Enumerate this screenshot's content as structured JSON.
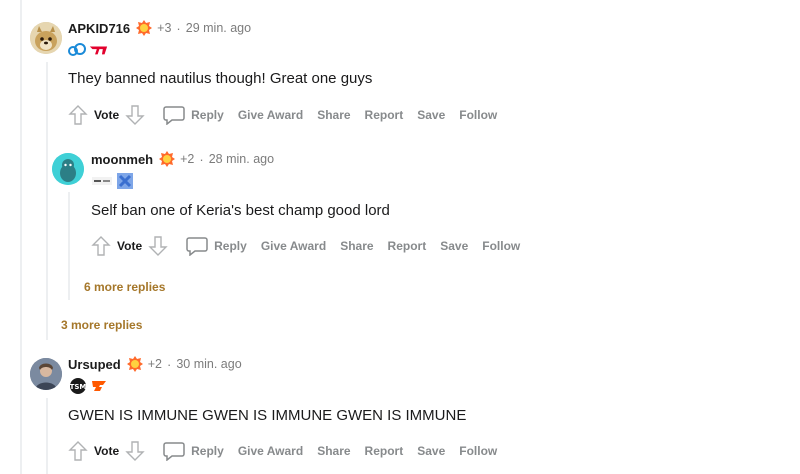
{
  "comments": [
    {
      "username": "APKID716",
      "awards": "+3",
      "time": "29 min. ago",
      "body": "They banned nautilus though! Great one guys",
      "flairs": [
        "cloud9-flair-icon",
        "t1-flair-icon"
      ]
    },
    {
      "username": "moonmeh",
      "awards": "+2",
      "time": "28 min. ago",
      "body": "Self ban one of Keria's best champ good lord",
      "flairs": [
        "team-text-flair-icon",
        "blue-x-flair-icon"
      ]
    },
    {
      "username": "Ursuped",
      "awards": "+2",
      "time": "30 min. ago",
      "body": "GWEN IS IMMUNE GWEN IS IMMUNE GWEN IS IMMUNE",
      "flairs": [
        "tsm-flair-icon",
        "fnatic-flair-icon"
      ]
    }
  ],
  "actions": {
    "vote": "Vote",
    "reply": "Reply",
    "give_award": "Give Award",
    "share": "Share",
    "report": "Report",
    "save": "Save",
    "follow": "Follow"
  },
  "more_replies": {
    "nested": "6 more replies",
    "top": "3 more replies"
  },
  "dot": "·",
  "colors": {
    "more_replies": "#a5772a",
    "action_gray": "#878a8c",
    "thread_line": "#edeff1"
  }
}
